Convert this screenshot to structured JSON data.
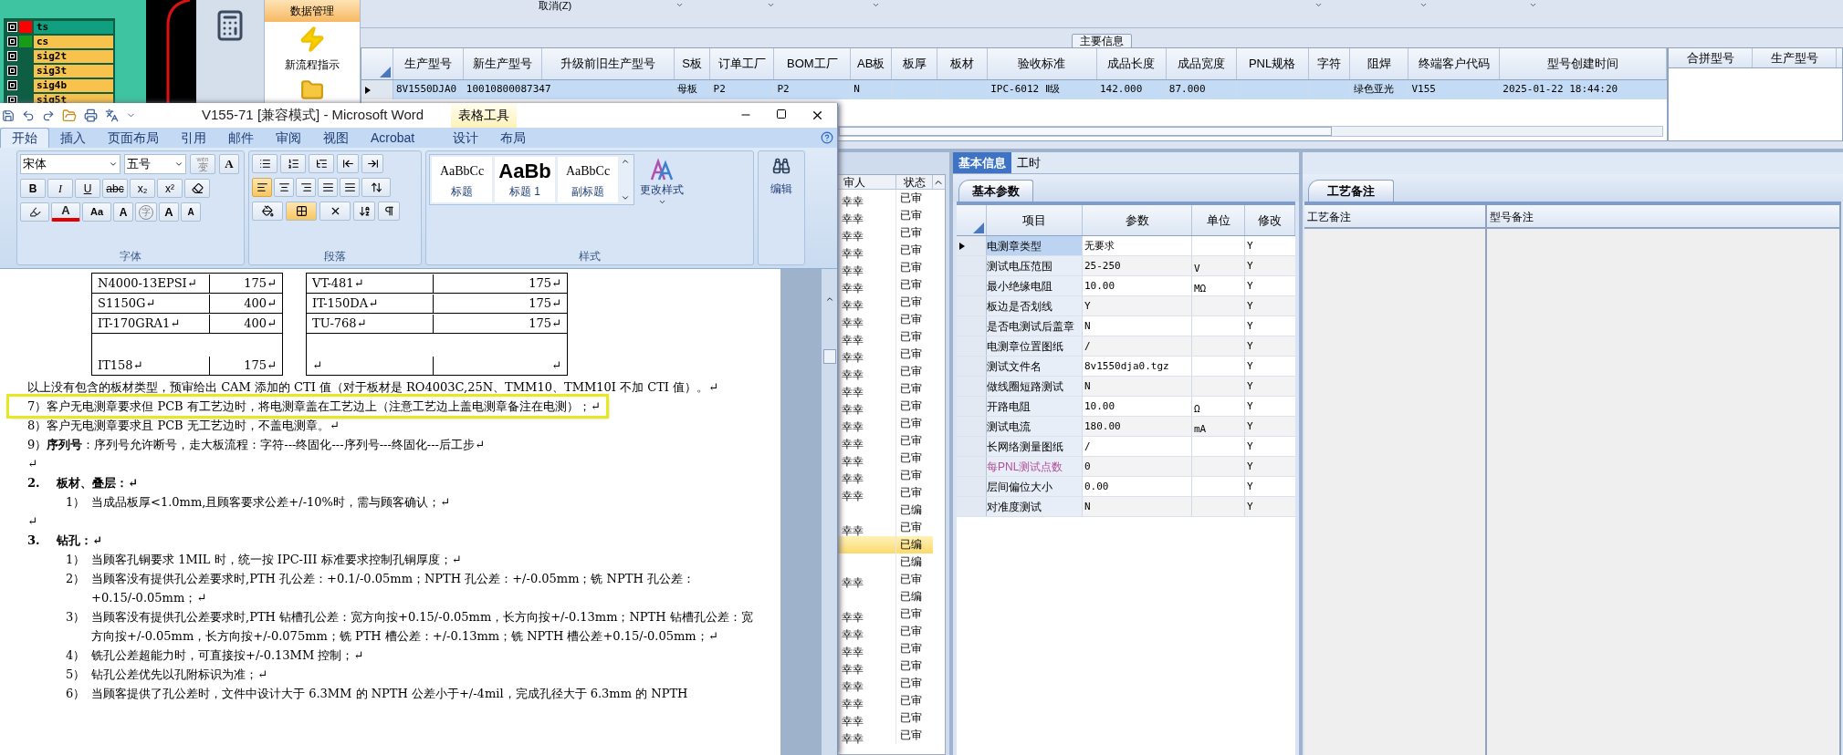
{
  "cad_layers": [
    {
      "name": "ts",
      "color": "#ff0000",
      "selected": true,
      "visible": true
    },
    {
      "name": "cs",
      "color": "#1a9a1a",
      "selected": false,
      "visible": true
    },
    {
      "name": "sig2t",
      "selected": false,
      "visible": true
    },
    {
      "name": "sig3t",
      "selected": false,
      "visible": true
    },
    {
      "name": "sig4b",
      "selected": false,
      "visible": true
    },
    {
      "name": "sig5t",
      "selected": false,
      "visible": true
    }
  ],
  "nav": {
    "header": "数据管理",
    "items": [
      {
        "label": "新流程指示"
      }
    ]
  },
  "toolbar": {
    "cancel": "取消(Z)"
  },
  "main_group": "主要信息",
  "grid": {
    "columns": [
      "生产型号",
      "新生产型号",
      "升级前旧生产型号",
      "S板",
      "订单工厂",
      "BOM工厂",
      "AB板",
      "板厚",
      "板材",
      "验收标准",
      "成品长度",
      "成品宽度",
      "PNL规格",
      "字符",
      "阻焊",
      "终端客户代码",
      "型号创建时间"
    ],
    "rows": [
      {
        "selected": true,
        "cells": [
          "8V1550DJA0",
          "10010800087347",
          null,
          "母板",
          "P2",
          "P2",
          "N",
          null,
          null,
          "IPC-6012 Ⅱ级",
          "142.000",
          "87.000",
          null,
          null,
          "绿色亚光",
          "V155",
          "2025-01-22 18:44:20"
        ]
      }
    ]
  },
  "merge_grid": {
    "columns": [
      "合拼型号",
      "生产型号"
    ]
  },
  "review_list": {
    "columns": [
      "审人",
      "状态"
    ],
    "rows": [
      {
        "reviewer": "幸幸",
        "status": "已审",
        "selected": false
      },
      {
        "reviewer": "幸幸",
        "status": "已审",
        "selected": false
      },
      {
        "reviewer": "幸幸",
        "status": "已审",
        "selected": false
      },
      {
        "reviewer": "幸幸",
        "status": "已审",
        "selected": false
      },
      {
        "reviewer": "幸幸",
        "status": "已审",
        "selected": false
      },
      {
        "reviewer": "幸幸",
        "status": "已审",
        "selected": false
      },
      {
        "reviewer": "幸幸",
        "status": "已审",
        "selected": false
      },
      {
        "reviewer": "幸幸",
        "status": "已审",
        "selected": false
      },
      {
        "reviewer": "幸幸",
        "status": "已审",
        "selected": false
      },
      {
        "reviewer": "幸幸",
        "status": "已审",
        "selected": false
      },
      {
        "reviewer": "幸幸",
        "status": "已审",
        "selected": false
      },
      {
        "reviewer": "幸幸",
        "status": "已审",
        "selected": false
      },
      {
        "reviewer": "幸幸",
        "status": "已审",
        "selected": false
      },
      {
        "reviewer": "幸幸",
        "status": "已审",
        "selected": false
      },
      {
        "reviewer": "幸幸",
        "status": "已审",
        "selected": false
      },
      {
        "reviewer": "幸幸",
        "status": "已审",
        "selected": false
      },
      {
        "reviewer": "幸幸",
        "status": "已审",
        "selected": false
      },
      {
        "reviewer": "幸幸",
        "status": "已审",
        "selected": false
      },
      {
        "status": "已编",
        "selected": false
      },
      {
        "reviewer": "幸幸",
        "status": "已审",
        "selected": false
      },
      {
        "status": "已编",
        "selected": true
      },
      {
        "status": "已编",
        "selected": false
      },
      {
        "reviewer": "幸幸",
        "status": "已审",
        "selected": false
      },
      {
        "status": "已编",
        "selected": false
      },
      {
        "reviewer": "幸幸",
        "status": "已审",
        "selected": false
      },
      {
        "reviewer": "幸幸",
        "status": "已审",
        "selected": false
      },
      {
        "reviewer": "幸幸",
        "status": "已审",
        "selected": false
      },
      {
        "reviewer": "幸幸",
        "status": "已审",
        "selected": false
      },
      {
        "reviewer": "幸幸",
        "status": "已审",
        "selected": false
      },
      {
        "reviewer": "幸幸",
        "status": "已审",
        "selected": false
      },
      {
        "reviewer": "幸幸",
        "status": "已审",
        "selected": false
      },
      {
        "reviewer": "幸幸",
        "status": "已审",
        "selected": false
      }
    ]
  },
  "detail_tabs": [
    {
      "label": "基本信息",
      "selected": true
    },
    {
      "label": "工时",
      "selected": false
    }
  ],
  "params": {
    "tab": "基本参数",
    "columns": [
      "项目",
      "参数",
      "单位",
      "修改"
    ],
    "rows": [
      {
        "item": "电测章类型",
        "value": "无要求",
        "modified": "Y",
        "selected": true,
        "disabled": false
      },
      {
        "item": "测试电压范围",
        "value": "25-250",
        "unit": "V",
        "modified": "Y",
        "selected": false,
        "disabled": false
      },
      {
        "item": "最小绝缘电阻",
        "value": "10.00",
        "unit": "MΩ",
        "modified": "Y",
        "selected": false,
        "disabled": false
      },
      {
        "item": "板边是否划线",
        "value": "Y",
        "modified": "Y",
        "selected": false,
        "disabled": false
      },
      {
        "item": "是否电测试后盖章",
        "value": "N",
        "modified": "Y",
        "selected": false,
        "disabled": false
      },
      {
        "item": "电测章位置图纸",
        "value": "/",
        "modified": "Y",
        "selected": false,
        "disabled": false
      },
      {
        "item": "测试文件名",
        "value": "8v1550dja0.tgz",
        "modified": "Y",
        "selected": false,
        "disabled": false
      },
      {
        "item": "做线圈短路测试",
        "value": "N",
        "modified": "Y",
        "selected": false,
        "disabled": false
      },
      {
        "item": "开路电阻",
        "value": "10.00",
        "unit": "Ω",
        "modified": "Y",
        "selected": false,
        "disabled": false
      },
      {
        "item": "测试电流",
        "value": "180.00",
        "unit": "mA",
        "modified": "Y",
        "selected": false,
        "disabled": false
      },
      {
        "item": "长网络测量图纸",
        "value": "/",
        "modified": "Y",
        "selected": false,
        "disabled": false
      },
      {
        "item": "每PNL测试点数",
        "value": "0",
        "modified": "Y",
        "selected": false,
        "disabled": true
      },
      {
        "item": "层间偏位大小",
        "value": "0.00",
        "modified": "Y",
        "selected": false,
        "disabled": false
      },
      {
        "item": "对准度测试",
        "value": "N",
        "modified": "Y",
        "selected": false,
        "disabled": false
      }
    ]
  },
  "notes": {
    "tab": "工艺备注",
    "columns": [
      "工艺备注",
      "型号备注"
    ]
  },
  "word": {
    "title": "V155-71 [兼容模式] - Microsoft Word",
    "context_tab": "表格工具",
    "tabs": [
      {
        "label": "开始",
        "selected": true
      },
      {
        "label": "插入",
        "selected": false
      },
      {
        "label": "页面布局",
        "selected": false
      },
      {
        "label": "引用",
        "selected": false
      },
      {
        "label": "邮件",
        "selected": false
      },
      {
        "label": "审阅",
        "selected": false
      },
      {
        "label": "视图",
        "selected": false
      },
      {
        "label": "Acrobat",
        "selected": false
      },
      {
        "label": "设计",
        "selected": false
      },
      {
        "label": "布局",
        "selected": false
      }
    ],
    "font_group": {
      "label": "字体",
      "font": "宋体",
      "size": "五号",
      "phonetic": "wén",
      "phonetic_char": "变",
      "border_char": "A",
      "format_buttons": [
        {
          "kind": "bold",
          "text": "B"
        },
        {
          "kind": "italic",
          "text": "I"
        },
        {
          "kind": "underline",
          "text": "U"
        },
        {
          "kind": "strike",
          "text": "abc"
        },
        {
          "kind": "sub",
          "text": "x₂"
        },
        {
          "kind": "sup",
          "text": "x²"
        }
      ],
      "color_buttons": [
        {
          "kind": "fontcolor",
          "text": "A"
        },
        {
          "kind": "case",
          "text": "Aa"
        },
        {
          "kind": "shade",
          "text": "A"
        },
        {
          "kind": "circle",
          "text": "字"
        },
        {
          "kind": "grow",
          "text": "A"
        },
        {
          "kind": "shrink",
          "text": "A"
        }
      ]
    },
    "paragraph_group": {
      "label": "段落",
      "alignments": [
        {
          "kind": "left",
          "selected": true
        },
        {
          "kind": "center",
          "selected": false
        },
        {
          "kind": "right",
          "selected": false
        },
        {
          "kind": "justify",
          "selected": false
        },
        {
          "kind": "distribute",
          "selected": false
        }
      ]
    },
    "styles_group": {
      "label": "样式",
      "styles": [
        {
          "preview": "AaBbCc",
          "name": "标题",
          "kind": "normal"
        },
        {
          "preview": "AaBb",
          "name": "标题 1",
          "kind": "big"
        },
        {
          "preview": "AaBbCc",
          "name": "副标题",
          "kind": "normal"
        }
      ],
      "change": "更改样式"
    },
    "edit_group": {
      "label": "编辑"
    },
    "doc": {
      "table": [
        [
          "N4000-13EPSI↵",
          "175↵",
          "VT-481↵",
          "175↵"
        ],
        [
          "S1150G↵",
          "400↵",
          "IT-150DA↵",
          "175↵"
        ],
        [
          "IT-170GRA1↵",
          "400↵",
          "TU-768↵",
          "175↵"
        ],
        [
          "IT158↵",
          "175↵",
          "↵",
          "↵"
        ]
      ],
      "paragraphs": [
        {
          "kind": "body",
          "text": "以上没有包含的板材类型，预审给出 CAM 添加的 CTI 值（对于板材是 RO4003C,25N、TMM10、TMM10I 不加 CTI 值）。↵",
          "highlighted": false
        },
        {
          "kind": "body",
          "text": "7）客户无电测章要求但 PCB 有工艺边时，将电测章盖在工艺边上（注意工艺边上盖电测章备注在电测）；↵",
          "highlighted": true
        },
        {
          "kind": "body",
          "text": "8）客户无电测章要求且 PCB 无工艺边时，不盖电测章。↵",
          "highlighted": false
        },
        {
          "kind": "body",
          "text": "9）**序列号**：序列号允许断号，走大板流程：字符---终固化---序列号---终固化---后工步↵",
          "highlighted": false
        },
        {
          "kind": "blank",
          "text": "↵"
        },
        {
          "kind": "heading",
          "number": "2.",
          "text": "板材、叠层：↵"
        },
        {
          "kind": "item",
          "number": "1）",
          "text": "当成品板厚<1.0mm,且顾客要求公差+/-10%时，需与顾客确认；↵"
        },
        {
          "kind": "blank",
          "text": "↵"
        },
        {
          "kind": "heading",
          "number": "3.",
          "text": "钻孔：↵"
        },
        {
          "kind": "item",
          "number": "1）",
          "text": "当顾客孔铜要求 1MIL 时，统一按 IPC-III 标准要求控制孔铜厚度；↵"
        },
        {
          "kind": "item",
          "number": "2）",
          "text": "当顾客没有提供孔公差要求时,PTH 孔公差：+0.1/-0.05mm；NPTH 孔公差：+/-0.05mm；铣 NPTH 孔公差：+0.15/-0.05mm；↵"
        },
        {
          "kind": "item",
          "number": "3）",
          "text": "当顾客没有提供孔公差要求时,PTH 钻槽孔公差：宽方向按+0.15/-0.05mm，长方向按+/-0.13mm；NPTH 钻槽孔公差：宽方向按+/-0.05mm，长方向按+/-0.075mm；铣 PTH 槽公差：+/-0.13mm；铣 NPTH 槽公差+0.15/-0.05mm；↵"
        },
        {
          "kind": "item",
          "number": "4）",
          "text": "铣孔公差超能力时，可直接按+/-0.13MM 控制；↵"
        },
        {
          "kind": "item",
          "number": "5）",
          "text": "钻孔公差优先以孔附标识为准；↵"
        },
        {
          "kind": "item",
          "number": "6）",
          "text": "当顾客提供了孔公差时，文件中设计大于 6.3MM 的 NPTH 公差小于+/-4mil，完成孔径大于 6.3mm 的 NPTH"
        }
      ]
    }
  }
}
